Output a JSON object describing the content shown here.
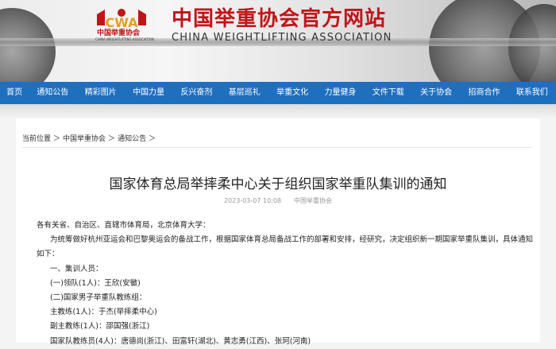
{
  "header": {
    "logo_text": "CWA",
    "logo_cn": "中国举重协会",
    "logo_en": "CHINA WEIGHTLIFTING ASSOCIATION",
    "title_cn": "中国举重协会官方网站",
    "title_en": "CHINA WEIGHTLIFTING ASSOCIATION",
    "brand_color": "#c0151a"
  },
  "nav": {
    "color": "#1f6fbf",
    "items": [
      "首页",
      "通知公告",
      "精彩图片",
      "中国力量",
      "反兴奋剂",
      "基层巡礼",
      "举重文化",
      "力量健身",
      "文件下载",
      "关于协会",
      "招商合作",
      "联系我们"
    ]
  },
  "breadcrumb": [
    "当前位置",
    "中国举重协会",
    "通知公告"
  ],
  "breadcrumb_sep": "＞",
  "article": {
    "title": "国家体育总局举摔柔中心关于组织国家举重队集训的通知",
    "date": "2023-03-07 10:08",
    "source": "中国举重协会",
    "paragraphs": [
      "各有关省、自治区、直辖市体育局，北京体育大学：",
      "为统筹做好杭州亚运会和巴黎奥运会的备战工作，根据国家体育总局备战工作的部署和安排，经研究，决定组织新一期国家举重队集训，具体通知",
      "如下：",
      "一、集训人员：",
      "(一)领队(1人)：王欣(安徽)",
      "(二)国家男子举重队教练组：",
      "主教练(1人)：于杰(举摔柔中心)",
      "副主教练(1人)：邵国强(浙江)",
      "国家队教练员(4人)：唐德尚(浙江)、田富轩(湖北)、黄志勇(江西)、张珂(河南)"
    ]
  }
}
